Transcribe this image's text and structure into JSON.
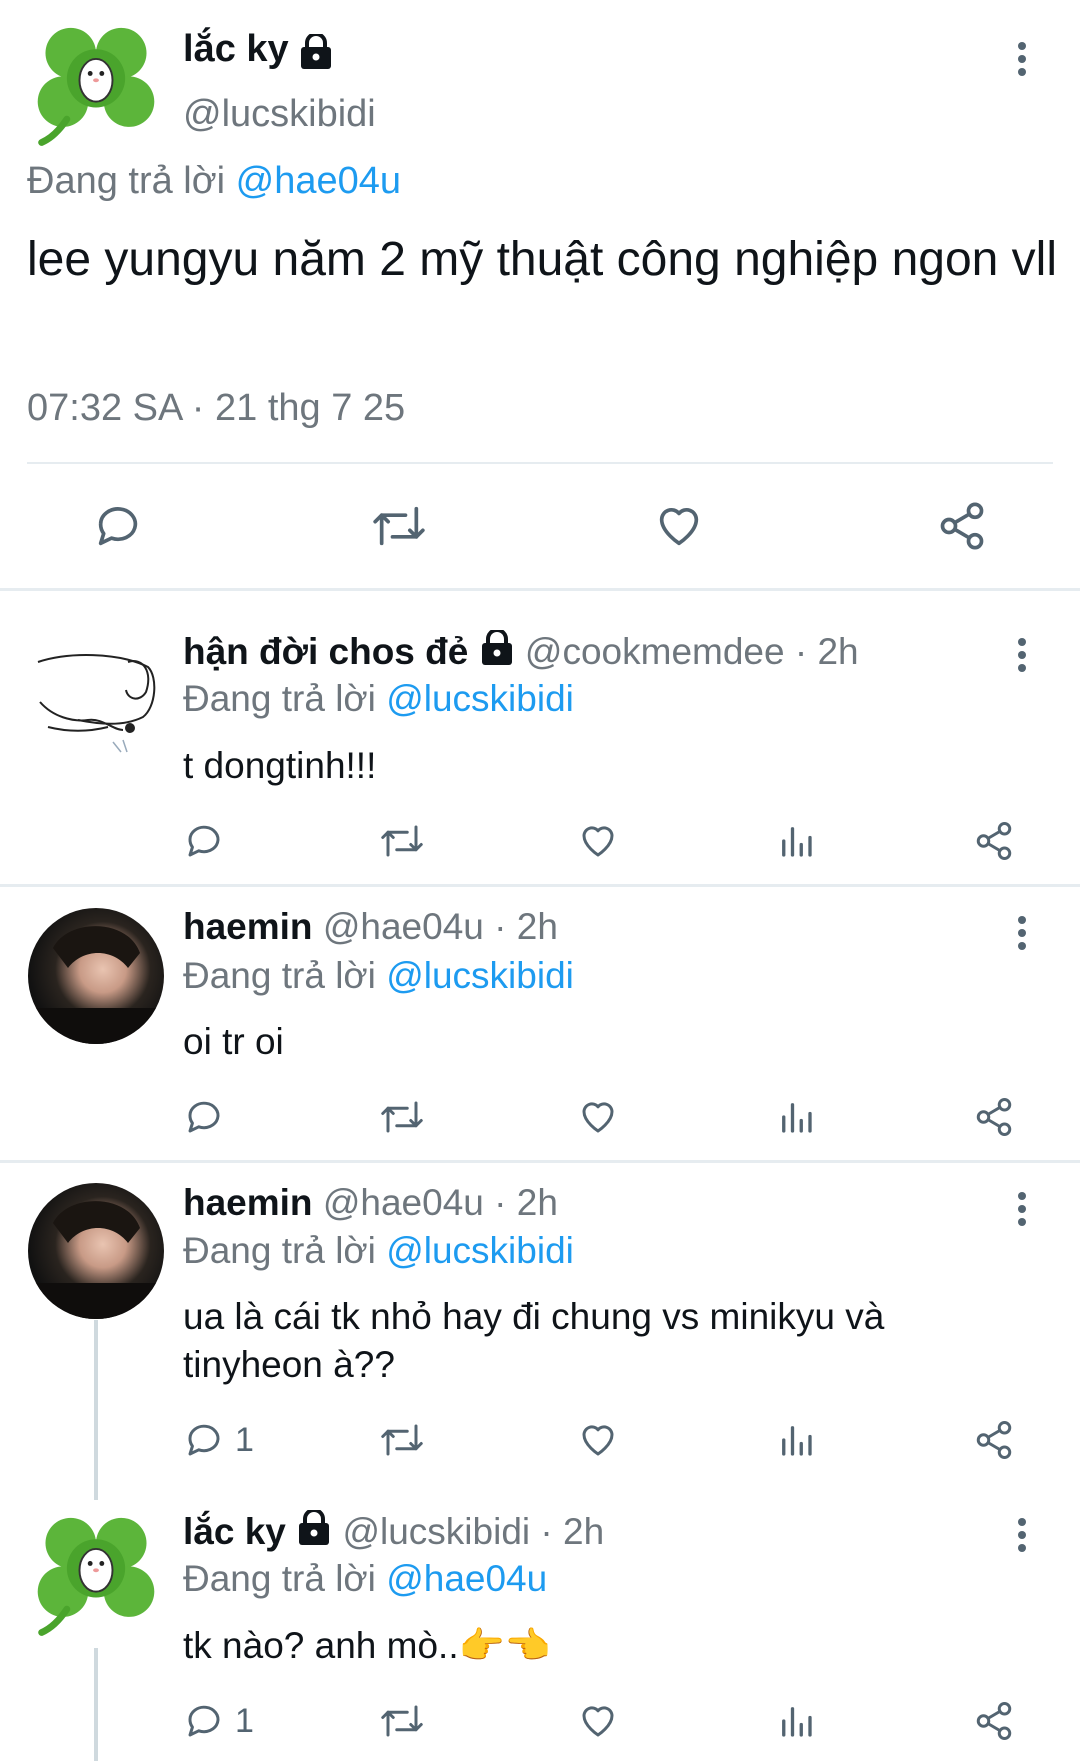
{
  "main_tweet": {
    "display_name": "lắc ky",
    "handle": "@lucskibidi",
    "replying_prefix": "Đang trả lời",
    "replying_to": "@hae04u",
    "text": "lee yungyu năm 2 mỹ thuật công nghiệp ngon vll",
    "timestamp": "07:32 SA · 21 thg 7 25",
    "protected": true
  },
  "replies": [
    {
      "display_name": "hận đời chos đẻ",
      "handle": "@cookmemdee",
      "time": "· 2h",
      "protected": true,
      "replying_prefix": "Đang trả lời",
      "replying_to": "@lucskibidi",
      "text": "t dongtinh!!!",
      "reply_count": ""
    },
    {
      "display_name": "haemin",
      "handle": "@hae04u",
      "time": "· 2h",
      "protected": false,
      "replying_prefix": "Đang trả lời",
      "replying_to": "@lucskibidi",
      "text": "oi tr oi",
      "reply_count": ""
    },
    {
      "display_name": "haemin",
      "handle": "@hae04u",
      "time": "· 2h",
      "protected": false,
      "replying_prefix": "Đang trả lời",
      "replying_to": "@lucskibidi",
      "text": "ua là cái tk nhỏ hay đi chung vs minikyu và tinyheon à??",
      "reply_count": "1"
    },
    {
      "display_name": "lắc ky",
      "handle": "@lucskibidi",
      "time": "· 2h",
      "protected": true,
      "replying_prefix": "Đang trả lời",
      "replying_to": "@hae04u",
      "text": "tk nào? anh mò..",
      "emoji": "👉👈",
      "reply_count": "1"
    }
  ],
  "icons": [
    "reply-icon",
    "retweet-icon",
    "like-icon",
    "analytics-icon",
    "share-icon",
    "lock-icon",
    "more-icon"
  ],
  "colors": {
    "link": "#1d9bf0",
    "muted": "#6e767d",
    "icon": "#536471",
    "clover": "#5cb53a"
  }
}
